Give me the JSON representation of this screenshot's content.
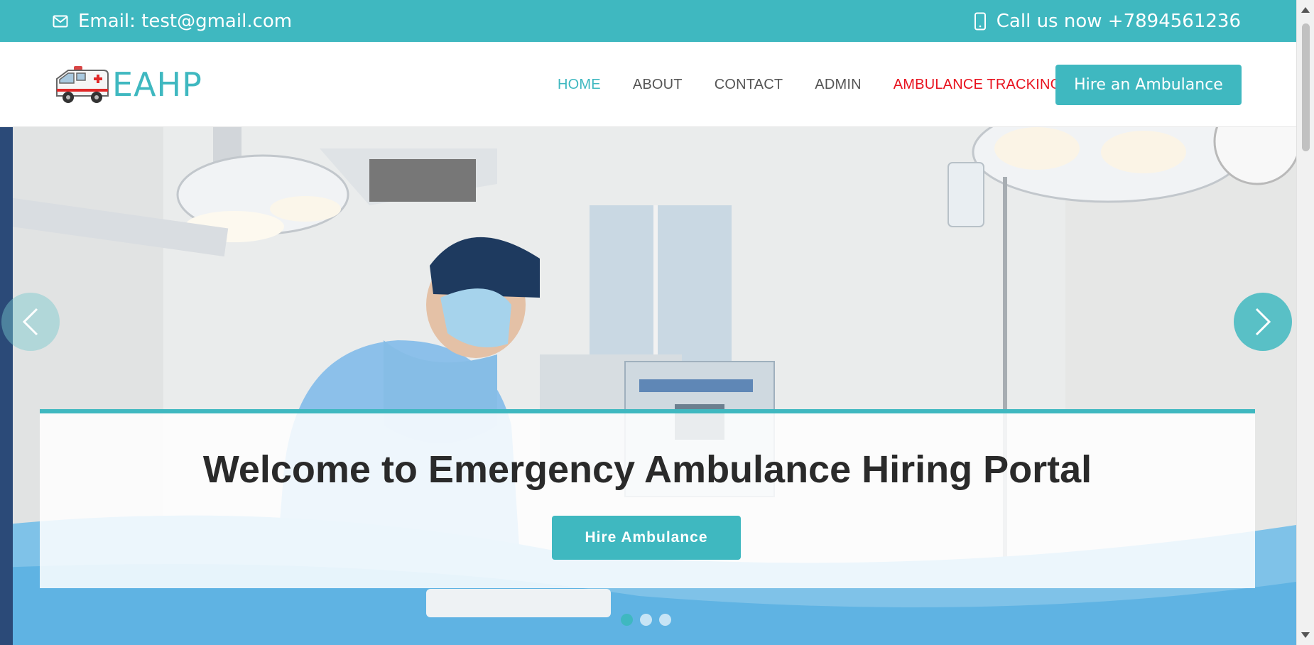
{
  "topbar": {
    "email": "Email: test@gmail.com",
    "phone": "Call us now +7894561236"
  },
  "header": {
    "logo_text": "EAHP",
    "nav": {
      "home": "HOME",
      "about": "ABOUT",
      "contact": "CONTACT",
      "admin": "ADMIN",
      "tracking": "AMBULANCE TRACKING"
    },
    "hire_button": "Hire an Ambulance"
  },
  "hero": {
    "title": "Welcome to Emergency Ambulance Hiring Portal",
    "cta": "Hire Ambulance",
    "slides": 3,
    "active_slide": 1
  },
  "colors": {
    "accent": "#3fb8c0",
    "tracking": "#e8121e",
    "text_dark": "#2a2a2a"
  }
}
